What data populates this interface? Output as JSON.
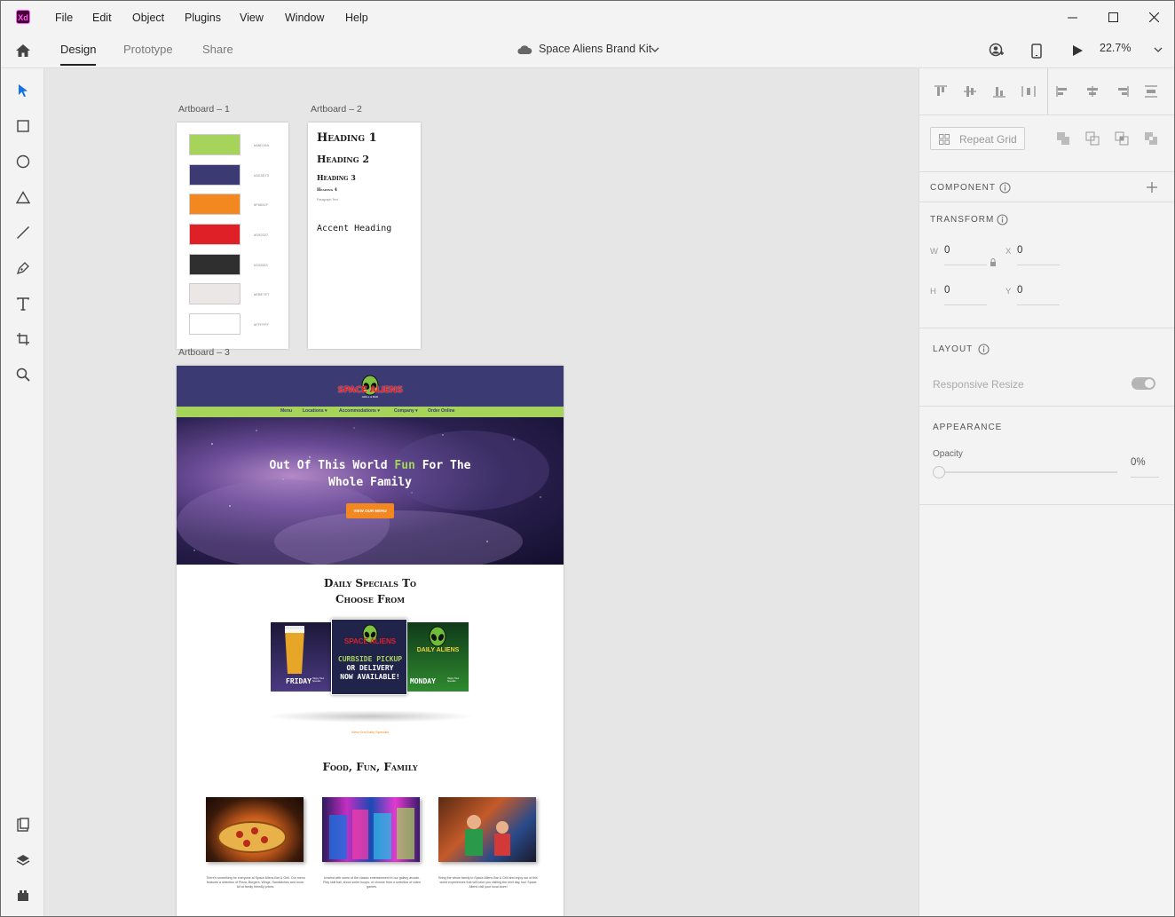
{
  "app": {
    "logo": "Xd"
  },
  "menu": {
    "items": [
      "File",
      "Edit",
      "Object",
      "Plugins",
      "View",
      "Window",
      "Help"
    ]
  },
  "toolbar": {
    "tabs": [
      "Design",
      "Prototype",
      "Share"
    ],
    "document_title": "Space Aliens Brand Kit",
    "zoom": "22.7%"
  },
  "canvas": {
    "artboards": [
      {
        "label": "Artboard – 1"
      },
      {
        "label": "Artboard – 2"
      },
      {
        "label": "Artboard – 3"
      }
    ],
    "palette": [
      {
        "color": "#A6D45B",
        "hex": "#A6D15A"
      },
      {
        "color": "#3C3A72",
        "hex": "#3D3D73"
      },
      {
        "color": "#F38820",
        "hex": "#F6831F"
      },
      {
        "color": "#E02027",
        "hex": "#D92027"
      },
      {
        "color": "#2F2F2F",
        "hex": "#333333"
      },
      {
        "color": "#EBE7E7",
        "hex": "#EBE7E7"
      },
      {
        "color": "#FFFFFF",
        "hex": "#FFFFFF"
      }
    ],
    "typography": {
      "h1": "Heading 1",
      "h2": "Heading 2",
      "h3": "Heading 3",
      "h4": "Heading 4",
      "paragraph": "Paragraph Text",
      "accent": "Accent Heading"
    },
    "site": {
      "logo_text": "SPACE ALIENS",
      "logo_sub": "GRILL & BAR",
      "nav": [
        "Menu",
        "Locations ▾",
        "Accommodations ▾",
        "Company ▾",
        "Order Online"
      ],
      "hero_line1_a": "Out Of This World ",
      "hero_line1_b": "Fun",
      "hero_line1_c": " For The",
      "hero_line2": "Whole Family",
      "hero_button": "VIEW OUR MENU",
      "specials_title_1": "Daily Specials To",
      "specials_title_2": "Choose From",
      "promo_left": "FRIDAY",
      "promo_left_small": "Happy Hour Specials",
      "promo_center_1": "CURBSIDE PICKUP",
      "promo_center_2": "OR DELIVERY",
      "promo_center_3": "NOW AVAILABLE!",
      "promo_right_logo": "DAILY ALIENS",
      "promo_right": "MONDAY",
      "promo_right_small": "Happy Hour Specials",
      "specials_link": "View Our Daily Specials",
      "family_title": "Food, Fun, Family",
      "para_1": "There's something for everyone at Space Aliens Bar & Grill. Our menu features a selection of Pizza, Burgers, Wings, Sandwiches and more. All at family friendly prices.",
      "para_2": "Unwind with some of the classic entertainment in our galaxy arcade. Play skill ball, shoot some hoops, or choose from a selection of video games.",
      "para_3": "Bring the whole family to Space Aliens Bar & Grill and enjoy out of this world experiences that will have you visiting the next day, too! Space Aliens visit your local store!"
    }
  },
  "panel": {
    "repeat_grid": "Repeat Grid",
    "component": "COMPONENT",
    "transform": "TRANSFORM",
    "w_label": "W",
    "w_value": "0",
    "x_label": "X",
    "x_value": "0",
    "h_label": "H",
    "h_value": "0",
    "y_label": "Y",
    "y_value": "0",
    "layout": "LAYOUT",
    "responsive_resize": "Responsive Resize",
    "appearance": "APPEARANCE",
    "opacity_label": "Opacity",
    "opacity_value": "0%"
  }
}
